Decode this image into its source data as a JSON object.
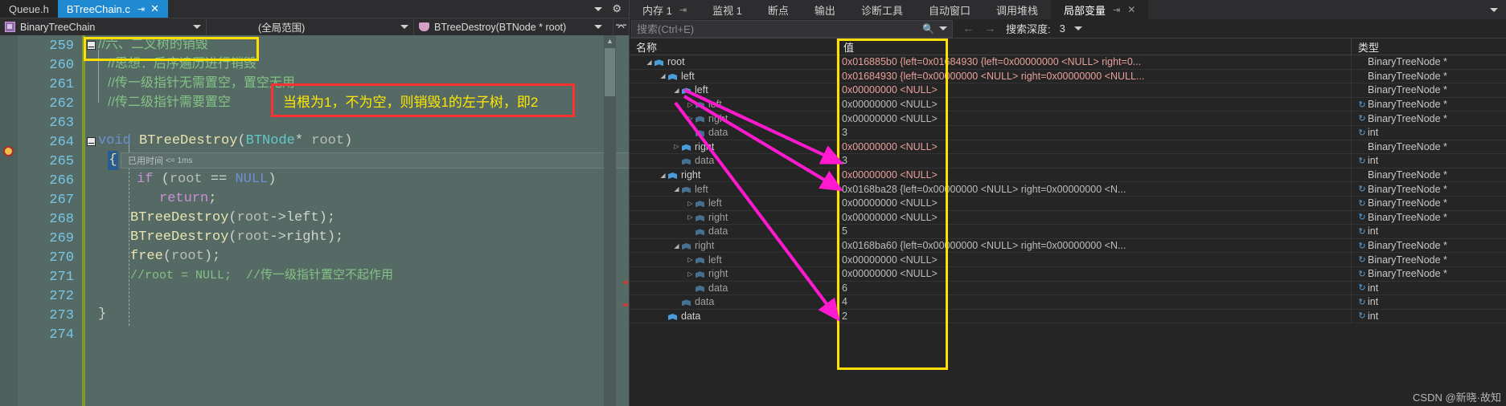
{
  "editor": {
    "tabs": [
      {
        "label": "Queue.h",
        "active": false,
        "pin": "",
        "close": ""
      },
      {
        "label": "BTreeChain.c",
        "active": true,
        "pin": "⇥",
        "close": "✕"
      }
    ],
    "nav": {
      "class_scope": "BinaryTreeChain",
      "scope_range": "(全局范围)",
      "method": "BTreeDestroy(BTNode * root)",
      "split_icon": "split-window-icon",
      "gear_icon": "gear-icon"
    },
    "gutter_icons": {
      "breakpoint": "breakpoint-icon",
      "outline_collapse": "−"
    },
    "perf_tip": {
      "label": "已用时间",
      "value": "<= 1ms"
    },
    "lines": [
      {
        "num": "259",
        "text": "//六、二叉树的销毁",
        "kind": "comment-cjk",
        "outline": true
      },
      {
        "num": "260",
        "text": "//思想：后序遍历进行销毁",
        "kind": "comment-cjk"
      },
      {
        "num": "261",
        "text": "//传一级指针无需置空，置空无用",
        "kind": "comment-cjk"
      },
      {
        "num": "262",
        "text": "//传二级指针需要置空",
        "kind": "comment-cjk"
      },
      {
        "num": "263",
        "text": "",
        "kind": "blank"
      },
      {
        "num": "264",
        "text": "void BTreeDestroy(BTNode* root)",
        "kind": "signature",
        "outline": true
      },
      {
        "num": "265",
        "text": "{",
        "kind": "brace-hl"
      },
      {
        "num": "266",
        "text": "if (root == NULL)",
        "kind": "code"
      },
      {
        "num": "267",
        "text": "return;",
        "kind": "code"
      },
      {
        "num": "268",
        "text": "BTreeDestroy(root->left);",
        "kind": "code"
      },
      {
        "num": "269",
        "text": "BTreeDestroy(root->right);",
        "kind": "code"
      },
      {
        "num": "270",
        "text": "free(root);",
        "kind": "code"
      },
      {
        "num": "271",
        "text": "//root = NULL;  //传一级指针置空不起作用",
        "kind": "comment-mono"
      },
      {
        "num": "272",
        "text": "",
        "kind": "blank"
      },
      {
        "num": "273",
        "text": "}",
        "kind": "code"
      },
      {
        "num": "274",
        "text": "",
        "kind": "blank"
      }
    ],
    "annotations": {
      "yellow_highlight_target": "line-259",
      "red_note": "当根为1，不为空，则销毁1的左子树，即2"
    }
  },
  "debug": {
    "tabs": [
      {
        "label": "内存 1",
        "pin": "⇥",
        "active": false
      },
      {
        "label": "监视 1",
        "active": false
      },
      {
        "label": "断点",
        "active": false
      },
      {
        "label": "输出",
        "active": false
      },
      {
        "label": "诊断工具",
        "active": false
      },
      {
        "label": "自动窗口",
        "active": false
      },
      {
        "label": "调用堆栈",
        "active": false
      },
      {
        "label": "局部变量",
        "pin": "⇥",
        "close": "✕",
        "active": true
      }
    ],
    "tabs_overflow_icon": "chevron-down-icon",
    "toolbar": {
      "search_placeholder": "搜索(Ctrl+E)",
      "search_value": "",
      "search_icon": "search-icon",
      "search_dropdown_icon": "chevron-down-icon",
      "prev_icon": "arrow-left-icon",
      "next_icon": "arrow-right-icon",
      "depth_label": "搜索深度:",
      "depth_value": "3",
      "depth_dropdown_icon": "chevron-down-icon"
    },
    "columns": {
      "name": "名称",
      "value": "值",
      "type": "类型"
    },
    "rows": [
      {
        "indent": 0,
        "exp": "open",
        "name": "root",
        "value": "0x016885b0 {left=0x01684930 {left=0x00000000 <NULL> right=0...",
        "type": "BinaryTreeNode *",
        "changed": true,
        "refresh": false,
        "dim": false
      },
      {
        "indent": 1,
        "exp": "open",
        "name": "left",
        "value": "0x01684930 {left=0x00000000 <NULL> right=0x00000000 <NULL...",
        "type": "BinaryTreeNode *",
        "changed": true,
        "refresh": false,
        "dim": false
      },
      {
        "indent": 2,
        "exp": "open",
        "name": "left",
        "value": "0x00000000 <NULL>",
        "type": "BinaryTreeNode *",
        "changed": true,
        "refresh": false,
        "dim": false
      },
      {
        "indent": 3,
        "exp": "closed",
        "name": "left",
        "value": "0x00000000 <NULL>",
        "type": "BinaryTreeNode *",
        "changed": false,
        "refresh": true,
        "dim": true
      },
      {
        "indent": 3,
        "exp": "closed",
        "name": "right",
        "value": "0x00000000 <NULL>",
        "type": "BinaryTreeNode *",
        "changed": false,
        "refresh": true,
        "dim": true
      },
      {
        "indent": 3,
        "exp": "none",
        "name": "data",
        "value": "3",
        "type": "int",
        "changed": false,
        "refresh": true,
        "dim": true
      },
      {
        "indent": 2,
        "exp": "closed",
        "name": "right",
        "value": "0x00000000 <NULL>",
        "type": "BinaryTreeNode *",
        "changed": true,
        "refresh": false,
        "dim": false
      },
      {
        "indent": 2,
        "exp": "none",
        "name": "data",
        "value": "3",
        "type": "int",
        "changed": false,
        "refresh": true,
        "dim": true
      },
      {
        "indent": 1,
        "exp": "open",
        "name": "right",
        "value": "0x00000000 <NULL>",
        "type": "BinaryTreeNode *",
        "changed": true,
        "refresh": false,
        "dim": false
      },
      {
        "indent": 2,
        "exp": "open",
        "name": "left",
        "value": "0x0168ba28 {left=0x00000000 <NULL> right=0x00000000 <N...",
        "type": "BinaryTreeNode *",
        "changed": false,
        "refresh": true,
        "dim": true
      },
      {
        "indent": 3,
        "exp": "closed",
        "name": "left",
        "value": "0x00000000 <NULL>",
        "type": "BinaryTreeNode *",
        "changed": false,
        "refresh": true,
        "dim": true
      },
      {
        "indent": 3,
        "exp": "closed",
        "name": "right",
        "value": "0x00000000 <NULL>",
        "type": "BinaryTreeNode *",
        "changed": false,
        "refresh": true,
        "dim": true
      },
      {
        "indent": 3,
        "exp": "none",
        "name": "data",
        "value": "5",
        "type": "int",
        "changed": false,
        "refresh": true,
        "dim": true
      },
      {
        "indent": 2,
        "exp": "open",
        "name": "right",
        "value": "0x0168ba60 {left=0x00000000 <NULL> right=0x00000000 <N...",
        "type": "BinaryTreeNode *",
        "changed": false,
        "refresh": true,
        "dim": true
      },
      {
        "indent": 3,
        "exp": "closed",
        "name": "left",
        "value": "0x00000000 <NULL>",
        "type": "BinaryTreeNode *",
        "changed": false,
        "refresh": true,
        "dim": true
      },
      {
        "indent": 3,
        "exp": "closed",
        "name": "right",
        "value": "0x00000000 <NULL>",
        "type": "BinaryTreeNode *",
        "changed": false,
        "refresh": true,
        "dim": true
      },
      {
        "indent": 3,
        "exp": "none",
        "name": "data",
        "value": "6",
        "type": "int",
        "changed": false,
        "refresh": true,
        "dim": true
      },
      {
        "indent": 2,
        "exp": "none",
        "name": "data",
        "value": "4",
        "type": "int",
        "changed": false,
        "refresh": true,
        "dim": true
      },
      {
        "indent": 1,
        "exp": "none",
        "name": "data",
        "value": "2",
        "type": "int",
        "changed": false,
        "refresh": true,
        "dim": false
      }
    ],
    "value_column_highlight": "yellow-box-around-value-column",
    "arrows": {
      "color": "#ff1ad0",
      "count": 3,
      "semantic": "magenta-pointer-arrows"
    }
  },
  "watermark": "CSDN @新晓·故知"
}
